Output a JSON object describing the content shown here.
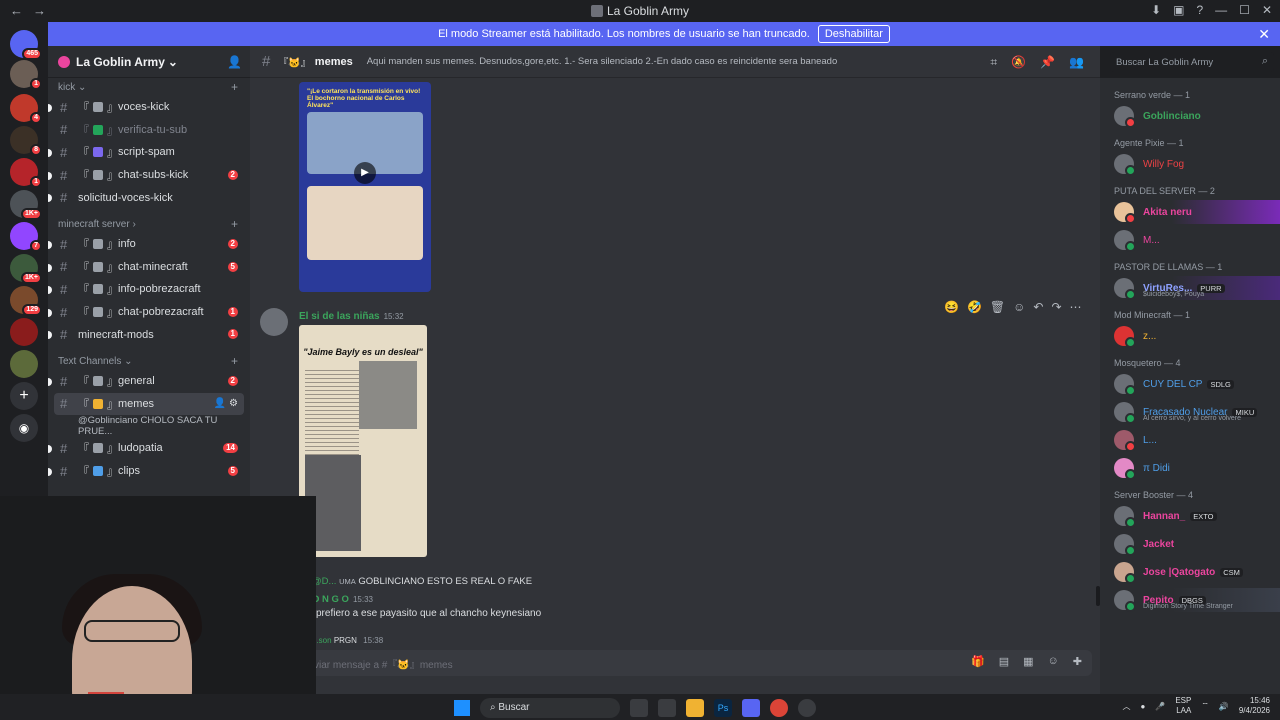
{
  "window": {
    "title": "La Goblin Army"
  },
  "banner": {
    "text": "El modo Streamer está habilitado. Los nombres de usuario se han truncado.",
    "button": "Deshabilitar"
  },
  "server": {
    "name": "La Goblin Army"
  },
  "server_list": [
    {
      "badge": "465"
    },
    {
      "badge": "1"
    },
    {
      "badge": "4"
    },
    {
      "badge": "8"
    },
    {
      "badge": "1"
    },
    {
      "badge": "1K+"
    },
    {
      "badge": "7"
    },
    {
      "badge": "1K+"
    },
    {
      "badge": "129"
    },
    {
      "badge": ""
    },
    {
      "badge": ""
    }
  ],
  "sidebar": {
    "cat_kick": "kick",
    "cat_minecraft": "minecraft server",
    "cat_text": "Text Channels",
    "channels": [
      {
        "name": "voces-kick",
        "badge": ""
      },
      {
        "name": "verifica-tu-sub",
        "badge": ""
      },
      {
        "name": "script-spam",
        "badge": ""
      },
      {
        "name": "chat-subs-kick",
        "badge": "2"
      },
      {
        "name": "solicitud-voces-kick",
        "badge": ""
      },
      {
        "name": "info",
        "badge": "2"
      },
      {
        "name": "chat-minecraft",
        "badge": "5"
      },
      {
        "name": "info-pobrezacraft",
        "badge": ""
      },
      {
        "name": "chat-pobrezacraft",
        "badge": "1"
      },
      {
        "name": "minecraft-mods",
        "badge": "1"
      },
      {
        "name": "general",
        "badge": "2"
      },
      {
        "name": "memes",
        "badge": ""
      },
      {
        "name": "ludopatia",
        "badge": "14"
      },
      {
        "name": "clips",
        "badge": "5"
      }
    ],
    "thread_preview": "@Goblinciano CHOLO SACA TU PRUE..."
  },
  "channel_header": {
    "name": "memes",
    "topic": "Aqui manden sus memes. Desnudos,gore,etc. 1.- Sera silenciado 2.-En dado caso es reincidente sera baneado",
    "search_placeholder": "Buscar La Goblin Army"
  },
  "messages": {
    "image1_headline_a": "\"¡Le cortaron la transmisión en vivo!",
    "image1_headline_b": "El bochorno nacional de Carlos Álvarez\"",
    "author2": "El si de las niñas",
    "time2": "15:32",
    "image2_title": "\"Jaime Bayly es un desleal\"",
    "reply_author": "@D...",
    "reply_tag": "UMA",
    "reply_text": "GOBLINCIANO ESTO ES REAL O FAKE",
    "author3": "O N G O",
    "time3": "15:33",
    "text3": "prefiero a ese payasito que al chancho keynesiano",
    "author4": "...son",
    "tag4": "PRGN",
    "time4": "15:38"
  },
  "composer": {
    "placeholder": "viar mensaje a #『🐱』memes"
  },
  "members": {
    "groups": [
      {
        "title": "Serrano verde — 1",
        "items": [
          {
            "name": "Goblinciano",
            "color": "#3ba55c",
            "tag": "",
            "status": "",
            "st": "#23a55a"
          }
        ]
      },
      {
        "title": "Agente Pixie — 1",
        "items": [
          {
            "name": "Willy Fog",
            "color": "#ed4245",
            "tag": "",
            "status": "",
            "st": "#23a55a"
          }
        ]
      },
      {
        "title": "PUTA DEL SERVER — 2",
        "items": [
          {
            "name": "Akita neru",
            "color": "#eb459e",
            "tag": "",
            "status": "",
            "st": "#f23f43"
          },
          {
            "name": "M...",
            "color": "#eb459e",
            "tag": "",
            "status": "",
            "st": "#23a55a"
          }
        ]
      },
      {
        "title": "PASTOR DE LLAMAS — 1",
        "items": [
          {
            "name": "VirtuRes...",
            "color": "#5865f2",
            "tag": "PURR",
            "status": "$uicideboy$, Pouya",
            "st": "#23a55a"
          }
        ]
      },
      {
        "title": "Mod Minecraft — 1",
        "items": [
          {
            "name": "z...",
            "color": "#f0b232",
            "tag": "",
            "status": "",
            "st": "#23a55a"
          }
        ]
      },
      {
        "title": "Mosquetero — 4",
        "items": [
          {
            "name": "CUY DEL CP",
            "color": "#4f9ee8",
            "tag": "SDLG",
            "status": "",
            "st": "#23a55a"
          },
          {
            "name": "Fracasado Nuclear",
            "color": "#4f9ee8",
            "tag": "MIKU",
            "status": "Al cerro sirvo, y al cerro volvere",
            "st": "#23a55a"
          },
          {
            "name": "L...",
            "color": "#4f9ee8",
            "tag": "",
            "status": "",
            "st": "#f23f43"
          },
          {
            "name": "π Didi",
            "color": "#4f9ee8",
            "tag": "",
            "status": "",
            "st": "#23a55a"
          }
        ]
      },
      {
        "title": "Server Booster — 4",
        "items": [
          {
            "name": "Hannan_",
            "color": "#eb459e",
            "tag": "EXTO",
            "status": "",
            "st": "#23a55a"
          },
          {
            "name": "Jacket",
            "color": "#eb459e",
            "tag": "",
            "status": "",
            "st": "#23a55a"
          },
          {
            "name": "Jose |Qatogato",
            "color": "#eb459e",
            "tag": "CSM",
            "status": "",
            "st": "#23a55a"
          },
          {
            "name": "Pepito",
            "color": "#eb459e",
            "tag": "DBGS",
            "status": "Digimon Story Time Stranger",
            "st": "#23a55a"
          }
        ]
      }
    ]
  },
  "taskbar": {
    "search": "Buscar",
    "lang1": "ESP",
    "lang2": "LAA",
    "time": "15:46",
    "date": "9/4/2026"
  }
}
